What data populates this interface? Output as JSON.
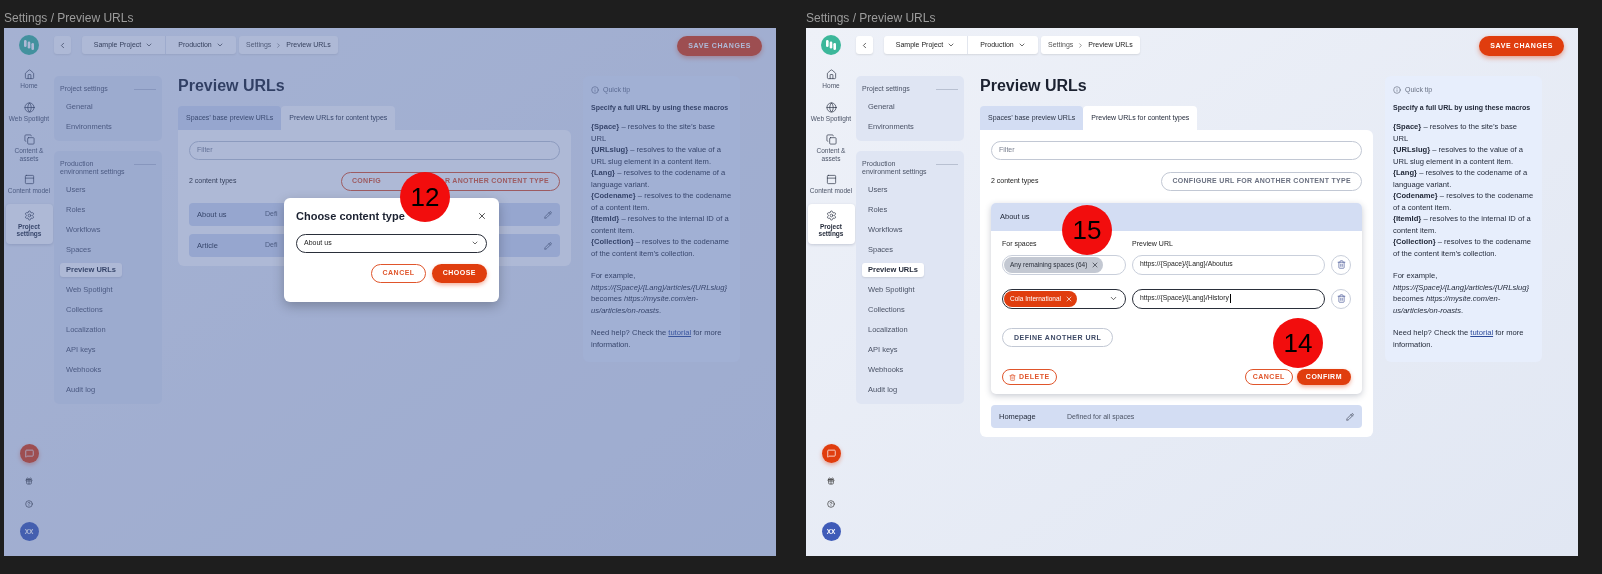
{
  "frames": [
    {
      "label": "Settings / Preview URLs",
      "nav": [
        {
          "label": "Home",
          "selected": false
        },
        {
          "label": "Web Spotlight",
          "selected": false
        },
        {
          "label": "Content & assets",
          "selected": false
        },
        {
          "label": "Content model",
          "selected": false
        },
        {
          "label": "Project settings",
          "selected": true
        }
      ],
      "avatar": "XX",
      "breadcrumbs": {
        "project": "Sample Project",
        "environment": "Production",
        "path": [
          "Settings",
          "Preview URLs"
        ]
      },
      "save_button": "SAVE CHANGES",
      "sidebar": [
        {
          "title": "Project settings",
          "items": [
            {
              "label": "General",
              "selected": false
            },
            {
              "label": "Environments",
              "selected": false
            }
          ]
        },
        {
          "title": "Production environment settings",
          "items": [
            {
              "label": "Users",
              "selected": false
            },
            {
              "label": "Roles",
              "selected": false
            },
            {
              "label": "Workflows",
              "selected": false
            },
            {
              "label": "Spaces",
              "selected": false
            },
            {
              "label": "Preview URLs",
              "selected": true
            },
            {
              "label": "Web Spotlight",
              "selected": false
            },
            {
              "label": "Collections",
              "selected": false
            },
            {
              "label": "Localization",
              "selected": false
            },
            {
              "label": "API keys",
              "selected": false
            },
            {
              "label": "Webhooks",
              "selected": false
            },
            {
              "label": "Audit log",
              "selected": false
            }
          ]
        }
      ],
      "page_title": "Preview URLs",
      "tabs": [
        {
          "label": "Spaces’ base preview URLs",
          "selected": false
        },
        {
          "label": "Preview URLs for content types",
          "selected": true
        }
      ],
      "filter": {
        "placeholder": "Filter"
      },
      "count": "2 content types",
      "configure_button": [
        "CONFIG",
        "R ANOTHER CONTENT TYPE"
      ],
      "content_types": [
        {
          "name": "About us",
          "description": "Defi",
          "expanded": false
        },
        {
          "name": "Article",
          "description": "Defi",
          "expanded": false
        }
      ],
      "quick_tip": {
        "title": "Quick tip",
        "heading": "Specify a full URL by using these macros",
        "macros": [
          "**{Space}** – resolves to the site’s base URL",
          "**{URLslug}** – resolves to the value of a URL slug element in a content item.",
          "**{Lang}** – resolves to the codename of a language variant.",
          "**{Codename}** – resolves to the codename of a content item.",
          "**{ItemId}** – resolves to the internal ID of a content item.",
          "**{Collection}** – resolves to the codename of the content item’s collection."
        ],
        "example": "For example, *https://{Space}/{Lang}/articles/{URLslug}* becomes *https://mysite.com/en-us/articles/on-roasts*.",
        "help": {
          "before": "Need help? Check the",
          "link": "tutorial",
          "after": "for more information."
        }
      },
      "modal": {
        "title": "Choose content type",
        "select": "About us",
        "cancel": "CANCEL",
        "confirm": "CHOOSE",
        "marker": "12"
      }
    },
    {
      "label": "Settings / Preview URLs",
      "nav": [
        {
          "label": "Home",
          "selected": false
        },
        {
          "label": "Web Spotlight",
          "selected": false
        },
        {
          "label": "Content & assets",
          "selected": false
        },
        {
          "label": "Content model",
          "selected": false
        },
        {
          "label": "Project settings",
          "selected": true
        }
      ],
      "avatar": "XX",
      "breadcrumbs": {
        "project": "Sample Project",
        "environment": "Production",
        "path": [
          "Settings",
          "Preview URLs"
        ]
      },
      "save_button": "SAVE CHANGES",
      "sidebar": [
        {
          "title": "Project settings",
          "items": [
            {
              "label": "General",
              "selected": false
            },
            {
              "label": "Environments",
              "selected": false
            }
          ]
        },
        {
          "title": "Production environment settings",
          "items": [
            {
              "label": "Users",
              "selected": false
            },
            {
              "label": "Roles",
              "selected": false
            },
            {
              "label": "Workflows",
              "selected": false
            },
            {
              "label": "Spaces",
              "selected": false
            },
            {
              "label": "Preview URLs",
              "selected": true
            },
            {
              "label": "Web Spotlight",
              "selected": false
            },
            {
              "label": "Collections",
              "selected": false
            },
            {
              "label": "Localization",
              "selected": false
            },
            {
              "label": "API keys",
              "selected": false
            },
            {
              "label": "Webhooks",
              "selected": false
            },
            {
              "label": "Audit log",
              "selected": false
            }
          ]
        }
      ],
      "page_title": "Preview URLs",
      "tabs": [
        {
          "label": "Spaces’ base preview URLs",
          "selected": false
        },
        {
          "label": "Preview URLs for content types",
          "selected": true
        }
      ],
      "filter": {
        "placeholder": "Filter"
      },
      "count": "2 content types",
      "configure_button": "CONFIGURE URL FOR ANOTHER CONTENT TYPE",
      "content_types": [
        {
          "name": "About us",
          "expanded": true,
          "marker": "15",
          "columns": [
            "For spaces",
            "Preview URL"
          ],
          "mappings": [
            {
              "spaces": "Any remaining spaces (64)",
              "url": "https://{Space}/{Lang}/Aboutus",
              "focused": false
            },
            {
              "spaces": "Cola International",
              "url": "https://{Space}/{Lang}/History",
              "focused": true
            }
          ],
          "define_button": "DEFINE ANOTHER URL",
          "delete_button": "DELETE",
          "cancel_button": "CANCEL",
          "confirm_button": "CONFIRM",
          "confirm_marker": "14"
        },
        {
          "name": "Homepage",
          "description": "Defined for all spaces",
          "expanded": false
        }
      ],
      "quick_tip": {
        "title": "Quick tip",
        "heading": "Specify a full URL by using these macros",
        "macros": [
          "**{Space}** – resolves to the site’s base URL",
          "**{URLslug}** – resolves to the value of a URL slug element in a content item.",
          "**{Lang}** – resolves to the codename of a language variant.",
          "**{Codename}** – resolves to the codename of a content item.",
          "**{ItemId}** – resolves to the internal ID of a content item.",
          "**{Collection}** – resolves to the codename of the content item’s collection."
        ],
        "example": "For example, *https://{Space}/{Lang}/articles/{URLslug}* becomes *https://mysite.com/en-us/articles/on-roasts*.",
        "help": {
          "before": "Need help? Check the",
          "link": "tutorial",
          "after": "for more information."
        }
      }
    }
  ]
}
